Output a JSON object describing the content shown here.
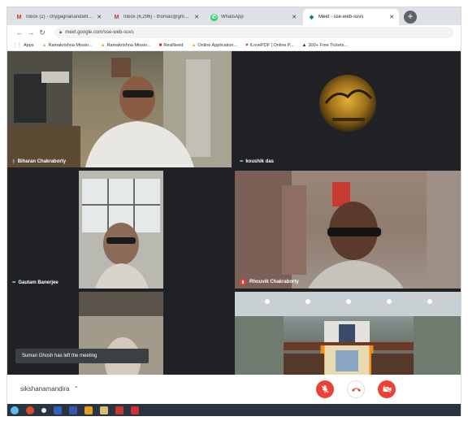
{
  "browser": {
    "tabs": [
      {
        "label": "Inbox (2) - chygagnanandafitn...",
        "icon": "gmail-icon",
        "active": false
      },
      {
        "label": "Inbox (6,296) - thomas@gmail...",
        "icon": "gmail-icon",
        "active": false
      },
      {
        "label": "WhatsApp",
        "icon": "whatsapp-icon",
        "active": false
      },
      {
        "label": "Meet - sse-web-suvs",
        "icon": "meet-icon",
        "active": true
      }
    ],
    "new_tab_symbol": "+",
    "url": "meet.google.com/sse-web-suvs",
    "bookmarks": [
      {
        "label": "Apps",
        "icon": "apps-grid-icon"
      },
      {
        "label": "Ramakrishna Missio...",
        "icon": "bookmark-folder-icon"
      },
      {
        "label": "Ramakrishna Missio...",
        "icon": "bookmark-folder-icon"
      },
      {
        "label": "ResiNeed",
        "icon": "resi-icon"
      },
      {
        "label": "Online Application...",
        "icon": "bookmark-folder-icon"
      },
      {
        "label": "ILovePDF | Online P...",
        "icon": "ilovepdf-icon"
      },
      {
        "label": "300+ Free Tickets...",
        "icon": "ticket-icon"
      }
    ]
  },
  "meet": {
    "participants": [
      {
        "name": "Biharan Chakraborty",
        "mic": "speaking"
      },
      {
        "name": "koushik das",
        "mic": "on"
      },
      {
        "name": "Gautam Banerjee",
        "mic": "on"
      },
      {
        "name": "Rhouvik Chakraborty",
        "mic": "muted"
      },
      {
        "name": "",
        "mic": "none"
      },
      {
        "name": "",
        "mic": "none"
      }
    ],
    "toast": "Suman Ghosh has left the meeting",
    "meeting_name": "sikshanamandira",
    "controls": [
      "mic-off-icon",
      "hang-up-icon",
      "camera-off-icon"
    ],
    "colors": {
      "danger": "#ea4335",
      "meet_bg": "#202124",
      "accent_blue": "#8ab4f8"
    }
  }
}
